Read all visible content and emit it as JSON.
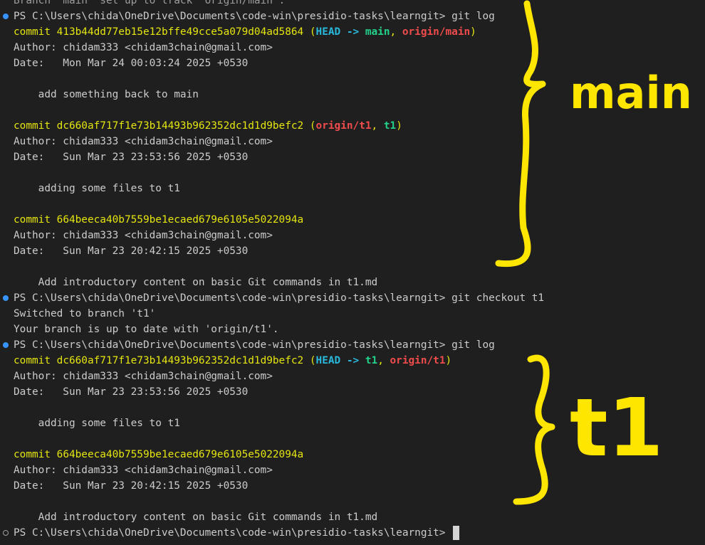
{
  "terminal": {
    "lines": [
      {
        "text": "Branch 'main' set up to track 'origin/main'.",
        "dot": "none"
      },
      {
        "text": "PS C:\\Users\\chida\\OneDrive\\Documents\\code-win\\presidio-tasks\\learngit> git log",
        "dot": "blue"
      },
      {
        "kind": "commit",
        "hash": "413b44dd77eb15e12bffe49cce5a079d04ad5864",
        "refs": [
          {
            "text": "HEAD -> ",
            "color": "cyan"
          },
          {
            "text": "main",
            "color": "green"
          },
          {
            "text": ", ",
            "color": "yellow"
          },
          {
            "text": "origin/main",
            "color": "red"
          }
        ]
      },
      {
        "text": "Author: chidam333 <chidam3chain@gmail.com>"
      },
      {
        "text": "Date:   Mon Mar 24 00:03:24 2025 +0530"
      },
      {
        "text": ""
      },
      {
        "text": "    add something back to main"
      },
      {
        "text": ""
      },
      {
        "kind": "commit",
        "hash": "dc660af717f1e73b14493b962352dc1d1d9befc2",
        "refs": [
          {
            "text": "origin/t1",
            "color": "red"
          },
          {
            "text": ", ",
            "color": "yellow"
          },
          {
            "text": "t1",
            "color": "green"
          }
        ]
      },
      {
        "text": "Author: chidam333 <chidam3chain@gmail.com>"
      },
      {
        "text": "Date:   Sun Mar 23 23:53:56 2025 +0530"
      },
      {
        "text": ""
      },
      {
        "text": "    adding some files to t1"
      },
      {
        "text": ""
      },
      {
        "kind": "commit",
        "hash": "664beeca40b7559be1ecaed679e6105e5022094a",
        "refs": []
      },
      {
        "text": "Author: chidam333 <chidam3chain@gmail.com>"
      },
      {
        "text": "Date:   Sun Mar 23 20:42:15 2025 +0530"
      },
      {
        "text": ""
      },
      {
        "text": "    Add introductory content on basic Git commands in t1.md"
      },
      {
        "text": "PS C:\\Users\\chida\\OneDrive\\Documents\\code-win\\presidio-tasks\\learngit> git checkout t1",
        "dot": "blue"
      },
      {
        "text": "Switched to branch 't1'"
      },
      {
        "text": "Your branch is up to date with 'origin/t1'."
      },
      {
        "text": "PS C:\\Users\\chida\\OneDrive\\Documents\\code-win\\presidio-tasks\\learngit> git log",
        "dot": "blue"
      },
      {
        "kind": "commit",
        "hash": "dc660af717f1e73b14493b962352dc1d1d9befc2",
        "refs": [
          {
            "text": "HEAD -> ",
            "color": "cyan"
          },
          {
            "text": "t1",
            "color": "green"
          },
          {
            "text": ", ",
            "color": "yellow"
          },
          {
            "text": "origin/t1",
            "color": "red"
          }
        ]
      },
      {
        "text": "Author: chidam333 <chidam3chain@gmail.com>"
      },
      {
        "text": "Date:   Sun Mar 23 23:53:56 2025 +0530"
      },
      {
        "text": ""
      },
      {
        "text": "    adding some files to t1"
      },
      {
        "text": ""
      },
      {
        "kind": "commit",
        "hash": "664beeca40b7559be1ecaed679e6105e5022094a",
        "refs": []
      },
      {
        "text": "Author: chidam333 <chidam3chain@gmail.com>"
      },
      {
        "text": "Date:   Sun Mar 23 20:42:15 2025 +0530"
      },
      {
        "text": ""
      },
      {
        "text": "    Add introductory content on basic Git commands in t1.md"
      },
      {
        "text": "PS C:\\Users\\chida\\OneDrive\\Documents\\code-win\\presidio-tasks\\learngit> ",
        "dot": "hollow",
        "cursor": true
      }
    ]
  },
  "annotations": {
    "main_label": "main",
    "t1_label": "t1",
    "color": "#ffe600"
  },
  "colors": {
    "background": "#1f1f1f",
    "text": "#cccccc",
    "commit": "#e5e510",
    "head": "#29b8db",
    "branch": "#23d18b",
    "remote": "#f14c4c",
    "prompt_dot": "#3794ff"
  }
}
